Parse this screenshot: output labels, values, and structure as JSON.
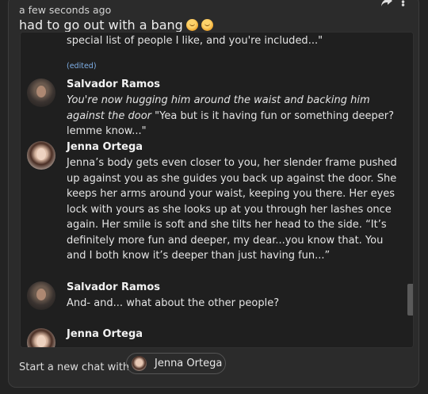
{
  "post": {
    "timestamp": "a few seconds ago",
    "title": "had to go out with a bang",
    "emojis": [
      "smiling-face-emoji",
      "smiling-face-emoji"
    ]
  },
  "toolbar": {
    "share_icon": "share-arrow-icon",
    "more_icon": "vertical-dots-icon"
  },
  "thread": {
    "partial_top_text": "special list of people I like, and you're included...\"",
    "edited_label": "(edited)",
    "messages": [
      {
        "name": "Salvador Ramos",
        "italic": "You're now hugging him around the waist and backing him against the door",
        "text": " \"Yea but is it having fun or something deeper? lemme know...\""
      },
      {
        "name": "Jenna Ortega",
        "text": "Jenna’s body gets even closer to you, her slender frame pushed up against you as she guides you back up against the door. She keeps her arms around your waist, keeping you there. Her eyes lock with yours as she looks up at you through her lashes once again. Her smile is soft and she tilts her head to the side. “It’s definitely more fun and deeper, my dear...you know that. You and I both know it’s deeper than just having fun...”"
      },
      {
        "name": "Salvador Ramos",
        "text": "And- and... what about the other people?"
      },
      {
        "name": "Jenna Ortega",
        "text": ""
      }
    ]
  },
  "footer": {
    "label": "Start a new chat with",
    "chip_name": "Jenna Ortega"
  }
}
